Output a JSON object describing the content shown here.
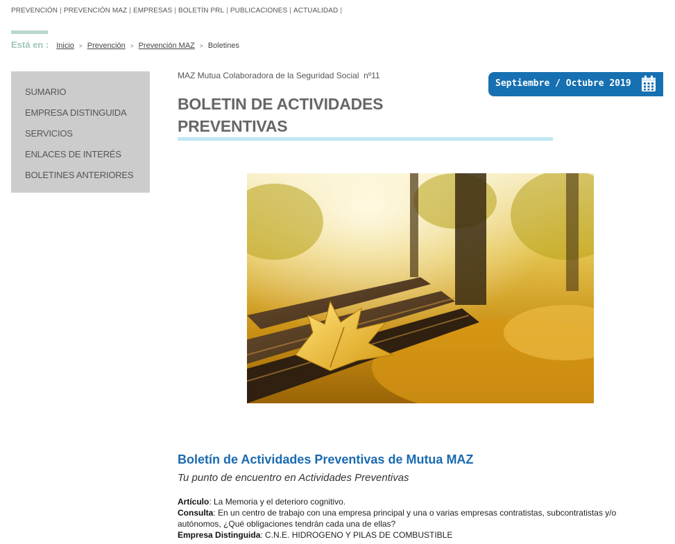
{
  "top_nav": {
    "items": [
      "PREVENCIÓN",
      "PREVENCIÓN MAZ",
      "EMPRESAS",
      "BOLETÍN PRL",
      "PUBLICACIONES",
      "ACTUALIDAD"
    ],
    "separator": "|"
  },
  "breadcrumb": {
    "label": "Está en :",
    "items": [
      "Inicio",
      "Prevención",
      "Prevención MAZ"
    ],
    "current": "Boletines"
  },
  "sidebar": {
    "items": [
      "SUMARIO",
      "EMPRESA DISTINGUIDA",
      "SERVICIOS",
      "ENLACES DE INTERÉS",
      "BOLETINES ANTERIORES"
    ]
  },
  "header": {
    "subtitle": "MAZ Mutua Colaboradora de la Seguridad Social  nº11",
    "title_line1": "BOLETIN DE ACTIVIDADES",
    "title_line2": "PREVENTIVAS",
    "date": "Septiembre / Octubre 2019",
    "date_icon": "calendar-icon"
  },
  "hero": {
    "icon": "autumn-leaf-photo"
  },
  "section": {
    "title": "Boletín de Actividades Preventivas de Mutua MAZ",
    "subtitle": "Tu punto de encuentro en Actividades Preventivas",
    "entries": [
      {
        "label": "Artículo",
        "text": ": La Memoria y el deterioro cognitivo."
      },
      {
        "label": "Consulta",
        "text": ": En un centro de trabajo con una empresa principal y una o varias empresas contratistas, subcontratistas y/o autónomos, ¿Qué obligaciones tendrán cada una de ellas?"
      },
      {
        "label": "Empresa Distinguida",
        "text": ": C.N.E. HIDROGENO Y PILAS DE COMBUSTIBLE"
      }
    ]
  },
  "colors": {
    "accent_blue": "#1670b1",
    "title_underline": "#c0e6f3",
    "sidebar_bg": "#cccccc",
    "breadcrumb_label": "#9fc6bd"
  }
}
